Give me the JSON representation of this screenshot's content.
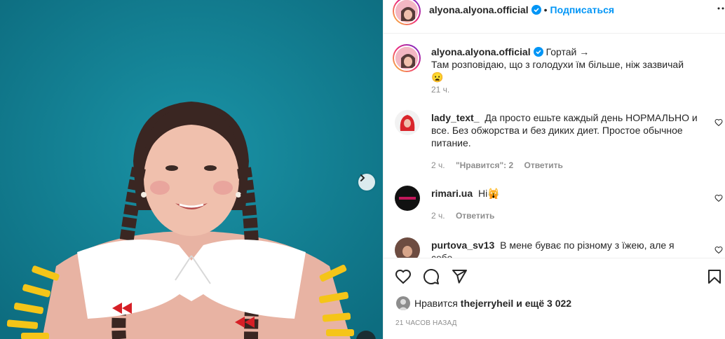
{
  "header": {
    "username": "alyona.alyona.official",
    "separator": "•",
    "follow_label": "Подписаться"
  },
  "caption": {
    "username": "alyona.alyona.official",
    "tag": "Гортай →",
    "text": "Там розповідаю, що з голодухи їм більше, ніж зазвичай 😦",
    "time": "21 ч."
  },
  "comments": [
    {
      "username": "lady_text_",
      "text": "Да просто ешьте каждый день НОРМАЛЬНО и все. Без обжорства и без диких диет. Простое обычное питание.",
      "time": "2 ч.",
      "likes": "\"Нравится\": 2",
      "reply": "Ответить"
    },
    {
      "username": "rimari.ua",
      "text": "Hi🙀",
      "time": "2 ч.",
      "reply": "Ответить"
    },
    {
      "username": "purtova_sv13",
      "text": "В мене буває по різному з їжею, але я себе"
    }
  ],
  "likes": {
    "prefix": "Нравится",
    "user": "thejerryheil",
    "suffix": "и ещё 3 022"
  },
  "timestamp": "21 часов назад",
  "icons": {
    "like": "heart-icon",
    "comment": "comment-icon",
    "share": "send-icon",
    "save": "bookmark-icon",
    "more": "more-icon",
    "next": "chevron-right-icon"
  },
  "colors": {
    "accent": "#0095f6",
    "verified": "#0095f6",
    "background_media": "#127e93"
  }
}
